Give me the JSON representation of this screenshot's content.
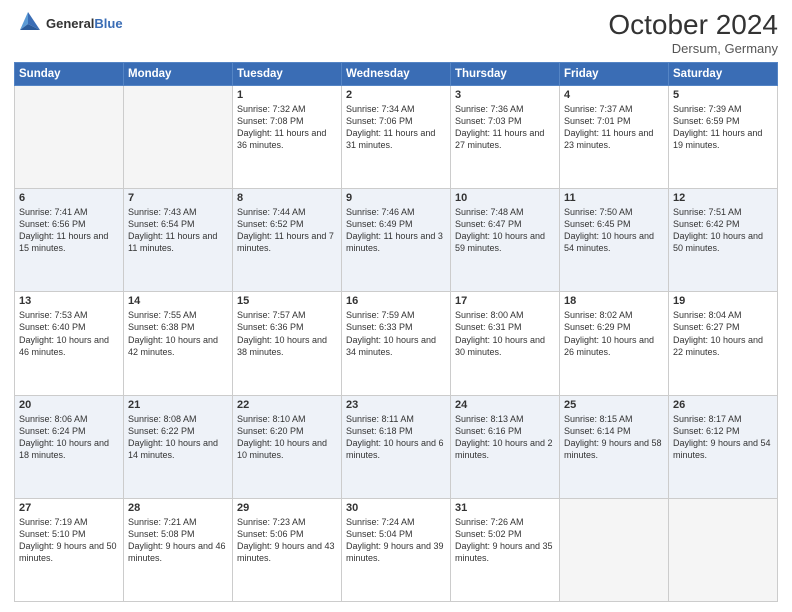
{
  "header": {
    "logo_general": "General",
    "logo_blue": "Blue",
    "month_year": "October 2024",
    "location": "Dersum, Germany"
  },
  "days_of_week": [
    "Sunday",
    "Monday",
    "Tuesday",
    "Wednesday",
    "Thursday",
    "Friday",
    "Saturday"
  ],
  "weeks": [
    [
      {
        "day": "",
        "empty": true
      },
      {
        "day": "",
        "empty": true
      },
      {
        "day": "1",
        "sunrise": "7:32 AM",
        "sunset": "7:08 PM",
        "daylight": "11 hours and 36 minutes."
      },
      {
        "day": "2",
        "sunrise": "7:34 AM",
        "sunset": "7:06 PM",
        "daylight": "11 hours and 31 minutes."
      },
      {
        "day": "3",
        "sunrise": "7:36 AM",
        "sunset": "7:03 PM",
        "daylight": "11 hours and 27 minutes."
      },
      {
        "day": "4",
        "sunrise": "7:37 AM",
        "sunset": "7:01 PM",
        "daylight": "11 hours and 23 minutes."
      },
      {
        "day": "5",
        "sunrise": "7:39 AM",
        "sunset": "6:59 PM",
        "daylight": "11 hours and 19 minutes."
      }
    ],
    [
      {
        "day": "6",
        "sunrise": "7:41 AM",
        "sunset": "6:56 PM",
        "daylight": "11 hours and 15 minutes."
      },
      {
        "day": "7",
        "sunrise": "7:43 AM",
        "sunset": "6:54 PM",
        "daylight": "11 hours and 11 minutes."
      },
      {
        "day": "8",
        "sunrise": "7:44 AM",
        "sunset": "6:52 PM",
        "daylight": "11 hours and 7 minutes."
      },
      {
        "day": "9",
        "sunrise": "7:46 AM",
        "sunset": "6:49 PM",
        "daylight": "11 hours and 3 minutes."
      },
      {
        "day": "10",
        "sunrise": "7:48 AM",
        "sunset": "6:47 PM",
        "daylight": "10 hours and 59 minutes."
      },
      {
        "day": "11",
        "sunrise": "7:50 AM",
        "sunset": "6:45 PM",
        "daylight": "10 hours and 54 minutes."
      },
      {
        "day": "12",
        "sunrise": "7:51 AM",
        "sunset": "6:42 PM",
        "daylight": "10 hours and 50 minutes."
      }
    ],
    [
      {
        "day": "13",
        "sunrise": "7:53 AM",
        "sunset": "6:40 PM",
        "daylight": "10 hours and 46 minutes."
      },
      {
        "day": "14",
        "sunrise": "7:55 AM",
        "sunset": "6:38 PM",
        "daylight": "10 hours and 42 minutes."
      },
      {
        "day": "15",
        "sunrise": "7:57 AM",
        "sunset": "6:36 PM",
        "daylight": "10 hours and 38 minutes."
      },
      {
        "day": "16",
        "sunrise": "7:59 AM",
        "sunset": "6:33 PM",
        "daylight": "10 hours and 34 minutes."
      },
      {
        "day": "17",
        "sunrise": "8:00 AM",
        "sunset": "6:31 PM",
        "daylight": "10 hours and 30 minutes."
      },
      {
        "day": "18",
        "sunrise": "8:02 AM",
        "sunset": "6:29 PM",
        "daylight": "10 hours and 26 minutes."
      },
      {
        "day": "19",
        "sunrise": "8:04 AM",
        "sunset": "6:27 PM",
        "daylight": "10 hours and 22 minutes."
      }
    ],
    [
      {
        "day": "20",
        "sunrise": "8:06 AM",
        "sunset": "6:24 PM",
        "daylight": "10 hours and 18 minutes."
      },
      {
        "day": "21",
        "sunrise": "8:08 AM",
        "sunset": "6:22 PM",
        "daylight": "10 hours and 14 minutes."
      },
      {
        "day": "22",
        "sunrise": "8:10 AM",
        "sunset": "6:20 PM",
        "daylight": "10 hours and 10 minutes."
      },
      {
        "day": "23",
        "sunrise": "8:11 AM",
        "sunset": "6:18 PM",
        "daylight": "10 hours and 6 minutes."
      },
      {
        "day": "24",
        "sunrise": "8:13 AM",
        "sunset": "6:16 PM",
        "daylight": "10 hours and 2 minutes."
      },
      {
        "day": "25",
        "sunrise": "8:15 AM",
        "sunset": "6:14 PM",
        "daylight": "9 hours and 58 minutes."
      },
      {
        "day": "26",
        "sunrise": "8:17 AM",
        "sunset": "6:12 PM",
        "daylight": "9 hours and 54 minutes."
      }
    ],
    [
      {
        "day": "27",
        "sunrise": "7:19 AM",
        "sunset": "5:10 PM",
        "daylight": "9 hours and 50 minutes."
      },
      {
        "day": "28",
        "sunrise": "7:21 AM",
        "sunset": "5:08 PM",
        "daylight": "9 hours and 46 minutes."
      },
      {
        "day": "29",
        "sunrise": "7:23 AM",
        "sunset": "5:06 PM",
        "daylight": "9 hours and 43 minutes."
      },
      {
        "day": "30",
        "sunrise": "7:24 AM",
        "sunset": "5:04 PM",
        "daylight": "9 hours and 39 minutes."
      },
      {
        "day": "31",
        "sunrise": "7:26 AM",
        "sunset": "5:02 PM",
        "daylight": "9 hours and 35 minutes."
      },
      {
        "day": "",
        "empty": true
      },
      {
        "day": "",
        "empty": true
      }
    ]
  ]
}
